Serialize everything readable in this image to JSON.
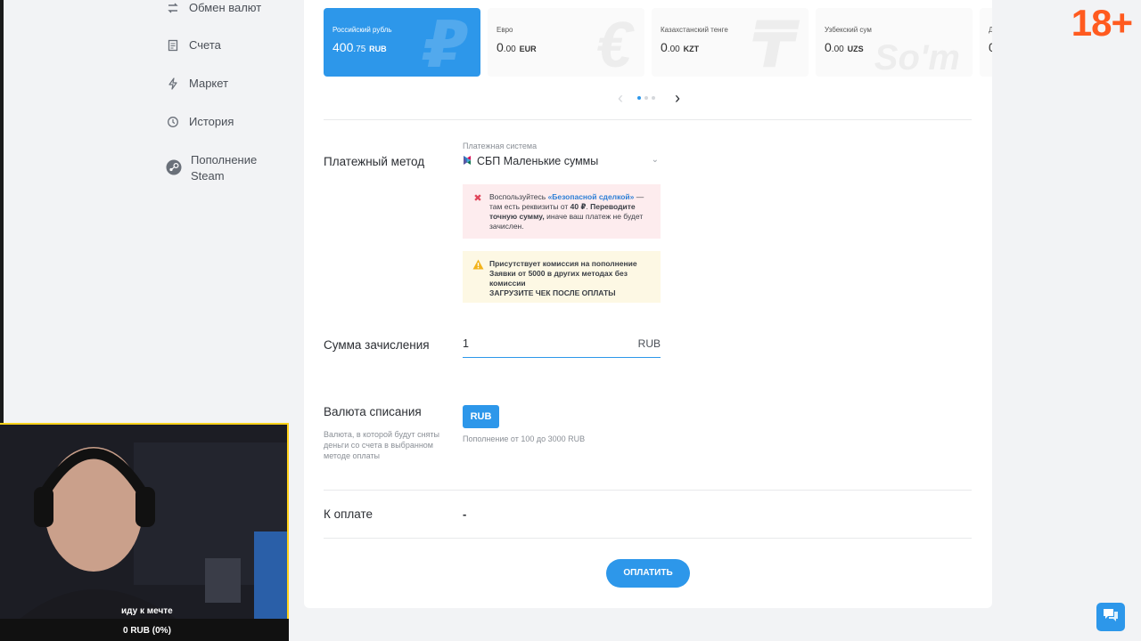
{
  "sidebar": {
    "items": [
      {
        "label": "Обмен валют",
        "icon": "exchange-icon"
      },
      {
        "label": "Счета",
        "icon": "document-icon"
      },
      {
        "label": "Маркет",
        "icon": "lightning-icon"
      },
      {
        "label": "История",
        "icon": "history-icon"
      },
      {
        "label": "Пополнение Steam",
        "icon": "steam-icon"
      }
    ]
  },
  "currencies": [
    {
      "name": "Российский рубль",
      "int": "400",
      "dec": ".75",
      "code": "RUB",
      "active": true,
      "watermark": "₽"
    },
    {
      "name": "Евро",
      "int": "0",
      "dec": ".00",
      "code": "EUR",
      "active": false,
      "watermark": "€"
    },
    {
      "name": "Казахстанский тенге",
      "int": "0",
      "dec": ".00",
      "code": "KZT",
      "active": false,
      "watermark": "₸"
    },
    {
      "name": "Узбекский сум",
      "int": "0",
      "dec": ".00",
      "code": "UZS",
      "active": false,
      "watermark": "So'm"
    },
    {
      "name": "Д",
      "int": "0",
      "dec": "",
      "code": "",
      "active": false,
      "watermark": ""
    }
  ],
  "payment": {
    "method_label": "Платежный метод",
    "system_caption": "Платежная система",
    "system_value": "СБП Маленькие суммы",
    "notice_pink": {
      "prefix": "Воспользуйтесь",
      "link": "«Безопасной сделкой»",
      "middle": "— там есть реквизиты от",
      "amount": "40 ₽",
      "bold": "Переводите точную сумму,",
      "suffix": "иначе ваш платеж не будет зачислен."
    },
    "notice_yellow": {
      "line1": "Присутствует комиссия на пополнение",
      "line2": "Заявки от 5000 в других методах без комиссии",
      "line3": "ЗАГРУЗИТЕ ЧЕК ПОСЛЕ ОПЛАТЫ"
    },
    "amount_label": "Сумма зачисления",
    "amount_value": "1",
    "amount_currency": "RUB",
    "currency_label": "Валюта списания",
    "currency_sub": "Валюта, в которой будут сняты деньги со счета в выбранном методе оплаты",
    "currency_button": "RUB",
    "range_note": "Пополнение от 100 до 3000 RUB",
    "to_pay_label": "К оплате",
    "to_pay_value": "-",
    "pay_button": "ОПЛАТИТЬ"
  },
  "overlay": {
    "age_badge": "18+",
    "cam_caption": "иду к мечте",
    "cam_goal": "0 RUB (0%)"
  },
  "colors": {
    "accent": "#2d97ea",
    "badge": "#ff5a1f",
    "cam_border": "#ffd21a"
  }
}
